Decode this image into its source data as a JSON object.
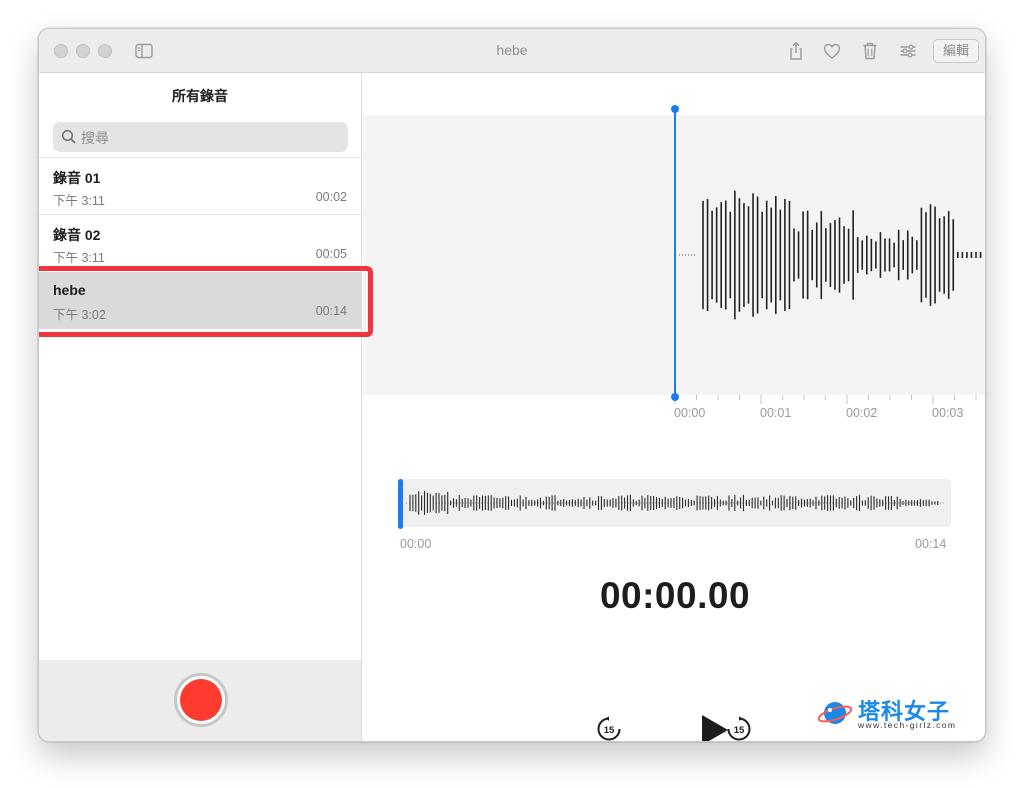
{
  "window": {
    "title": "hebe"
  },
  "toolbar": {
    "edit_label": "編輯"
  },
  "sidebar": {
    "title": "所有錄音",
    "search_placeholder": "搜尋",
    "recordings": [
      {
        "name": "錄音 01",
        "time": "下午 3:11",
        "duration": "00:02"
      },
      {
        "name": "錄音 02",
        "time": "下午 3:11",
        "duration": "00:05"
      },
      {
        "name": "hebe",
        "time": "下午 3:02",
        "duration": "00:14"
      }
    ],
    "selected_index": 2
  },
  "waveform": {
    "ticks": [
      "00:00",
      "00:01",
      "00:02",
      "00:03"
    ]
  },
  "overview": {
    "start": "00:00",
    "end": "00:14",
    "playhead_fraction": 0
  },
  "player": {
    "current_time": "00:00.00",
    "skip_seconds": "15"
  },
  "watermark": {
    "brand": "塔科女子",
    "url": "www.tech-girlz.com"
  },
  "colors": {
    "accent": "#1a7cf5",
    "record": "#ff3b30",
    "highlight_box": "#f2343f",
    "watermark": "#1a88e6"
  },
  "icons": [
    "sidebar-toggle-icon",
    "share-icon",
    "heart-icon",
    "trash-icon",
    "sliders-icon",
    "search-icon",
    "skip-back-15-icon",
    "play-icon",
    "skip-forward-15-icon"
  ]
}
